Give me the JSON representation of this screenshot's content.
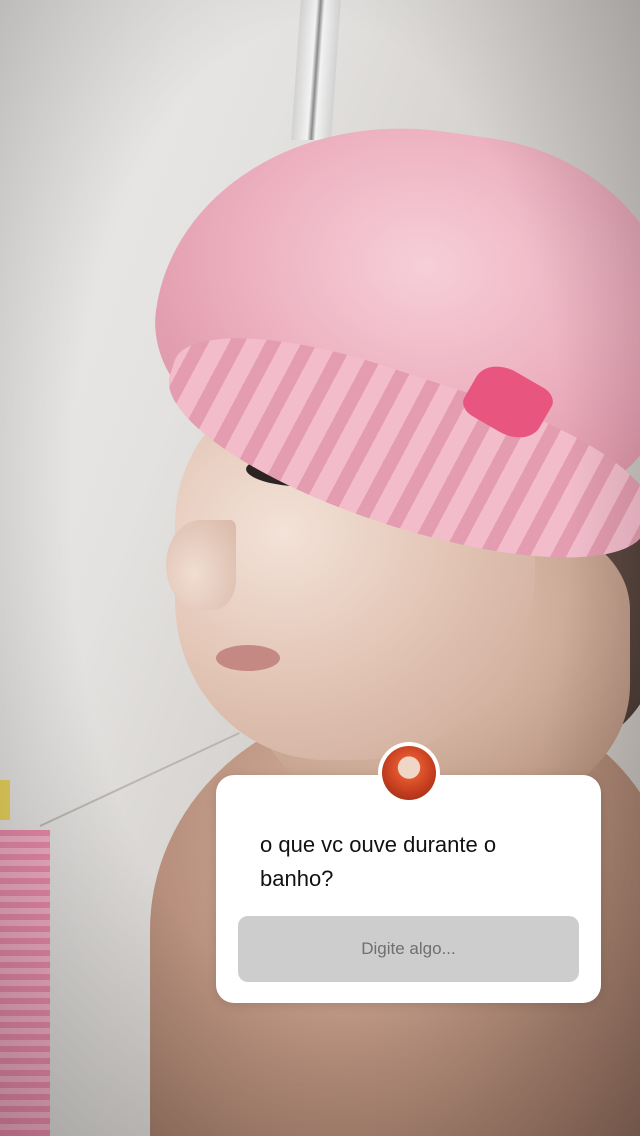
{
  "question_sticker": {
    "question": "o que vc ouve durante o banho?",
    "answer_placeholder": "Digite algo..."
  },
  "colors": {
    "sticker_background": "#ffffff",
    "answer_field_background": "#cdcdcd",
    "placeholder_text": "#6f6f6f",
    "question_text": "#111111",
    "shower_cap": "#eeb3c2"
  }
}
